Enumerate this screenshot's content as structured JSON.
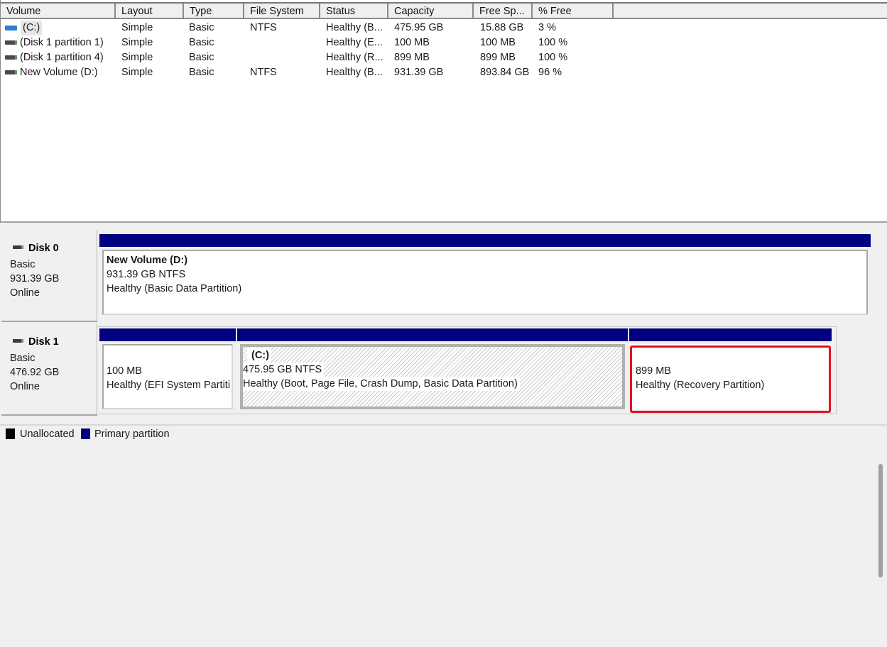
{
  "volume_list": {
    "columns": [
      "Volume",
      "Layout",
      "Type",
      "File System",
      "Status",
      "Capacity",
      "Free Sp...",
      "% Free"
    ],
    "rows": [
      {
        "icon": "system-drive-icon",
        "volume": "(C:)",
        "layout": "Simple",
        "type": "Basic",
        "file_system": "NTFS",
        "status": "Healthy (B...",
        "capacity": "475.95 GB",
        "free_space": "15.88 GB",
        "percent_free": "3 %"
      },
      {
        "icon": "drive-icon",
        "volume": "(Disk 1 partition 1)",
        "layout": "Simple",
        "type": "Basic",
        "file_system": "",
        "status": "Healthy (E...",
        "capacity": "100 MB",
        "free_space": "100 MB",
        "percent_free": "100 %"
      },
      {
        "icon": "drive-icon",
        "volume": "(Disk 1 partition 4)",
        "layout": "Simple",
        "type": "Basic",
        "file_system": "",
        "status": "Healthy (R...",
        "capacity": "899 MB",
        "free_space": "899 MB",
        "percent_free": "100 %"
      },
      {
        "icon": "drive-icon",
        "volume": "New Volume (D:)",
        "layout": "Simple",
        "type": "Basic",
        "file_system": "NTFS",
        "status": "Healthy (B...",
        "capacity": "931.39 GB",
        "free_space": "893.84 GB",
        "percent_free": "96 %"
      }
    ]
  },
  "disks": [
    {
      "name": "Disk 0",
      "type": "Basic",
      "size": "931.39 GB",
      "state": "Online",
      "partitions": [
        {
          "title": "New Volume  (D:)",
          "size_fs": "931.39 GB NTFS",
          "status": "Healthy (Basic Data Partition)"
        }
      ]
    },
    {
      "name": "Disk 1",
      "type": "Basic",
      "size": "476.92 GB",
      "state": "Online",
      "partitions": [
        {
          "title": "",
          "size_fs": "100 MB",
          "status": "Healthy (EFI System Partiti"
        },
        {
          "title": "(C:)",
          "size_fs": "475.95 GB NTFS",
          "status": "Healthy (Boot, Page File, Crash Dump, Basic Data Partition)"
        },
        {
          "title": "",
          "size_fs": "899 MB",
          "status": "Healthy (Recovery Partition)",
          "highlighted": true
        }
      ]
    }
  ],
  "legend": [
    {
      "label": "Unallocated",
      "color": "#000000"
    },
    {
      "label": "Primary partition",
      "color": "#000080"
    }
  ],
  "colors": {
    "primary_partition": "#000080",
    "highlight": "#e0141e"
  }
}
